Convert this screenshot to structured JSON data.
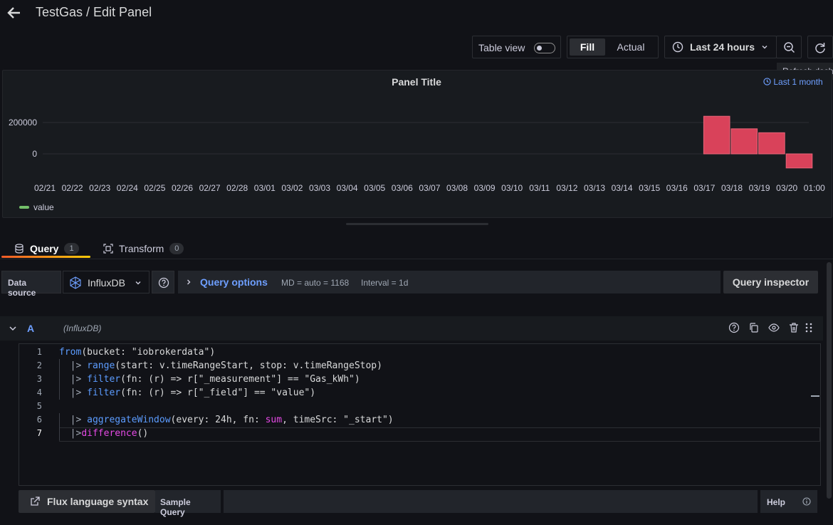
{
  "header": {
    "title": "TestGas / Edit Panel"
  },
  "toolbar": {
    "table_view_label": "Table view",
    "fill_label": "Fill",
    "actual_label": "Actual",
    "time_range_label": "Last 24 hours",
    "refresh_tooltip": "Refresh dashboard"
  },
  "panel": {
    "title": "Panel Title",
    "time_override": "Last 1 month"
  },
  "chart_data": {
    "type": "bar",
    "yticks": [
      "200000",
      "0"
    ],
    "categories": [
      "02/21",
      "02/22",
      "02/23",
      "02/24",
      "02/25",
      "02/26",
      "02/27",
      "02/28",
      "03/01",
      "03/02",
      "03/03",
      "03/04",
      "03/05",
      "03/06",
      "03/07",
      "03/08",
      "03/09",
      "03/10",
      "03/11",
      "03/12",
      "03/13",
      "03/14",
      "03/15",
      "03/16",
      "03/17",
      "03/18",
      "03/19",
      "03/20",
      "01:00"
    ],
    "values": [
      null,
      null,
      null,
      null,
      null,
      null,
      null,
      null,
      null,
      null,
      null,
      null,
      null,
      null,
      null,
      null,
      null,
      null,
      null,
      null,
      null,
      null,
      null,
      null,
      240000,
      160000,
      135000,
      -90000,
      null
    ],
    "series": [
      {
        "name": "value",
        "color": "#73bf69"
      }
    ],
    "bar_color": "#d9425a",
    "ylim": [
      -120000,
      300000
    ],
    "grid": true,
    "legend_position": "bottom-left"
  },
  "tabs": [
    {
      "label": "Query",
      "count": "1"
    },
    {
      "label": "Transform",
      "count": "0"
    }
  ],
  "query_row": {
    "data_source_label": "Data source",
    "data_source_value": "InfluxDB",
    "query_options_label": "Query options",
    "md": "MD = auto = 1168",
    "interval": "Interval = 1d",
    "inspector_label": "Query inspector"
  },
  "query_a": {
    "letter": "A",
    "datasource": "(InfluxDB)"
  },
  "editor": {
    "lines": [
      {
        "n": "1",
        "code": "from(bucket: \"iobrokerdata\")"
      },
      {
        "n": "2",
        "code": "  |> range(start: v.timeRangeStart, stop: v.timeRangeStop)"
      },
      {
        "n": "3",
        "code": "  |> filter(fn: (r) => r[\"_measurement\"] == \"Gas_kWh\")"
      },
      {
        "n": "4",
        "code": "  |> filter(fn: (r) => r[\"_field\"] == \"value\")"
      },
      {
        "n": "5",
        "code": ""
      },
      {
        "n": "6",
        "code": "  |> aggregateWindow(every: 24h, fn: sum, timeSrc: \"_start\")"
      },
      {
        "n": "7",
        "code": "  |>difference()"
      }
    ]
  },
  "bottom": {
    "flux_syntax_label": "Flux language syntax",
    "sample_query_label": "Sample Query",
    "help_label": "Help"
  }
}
